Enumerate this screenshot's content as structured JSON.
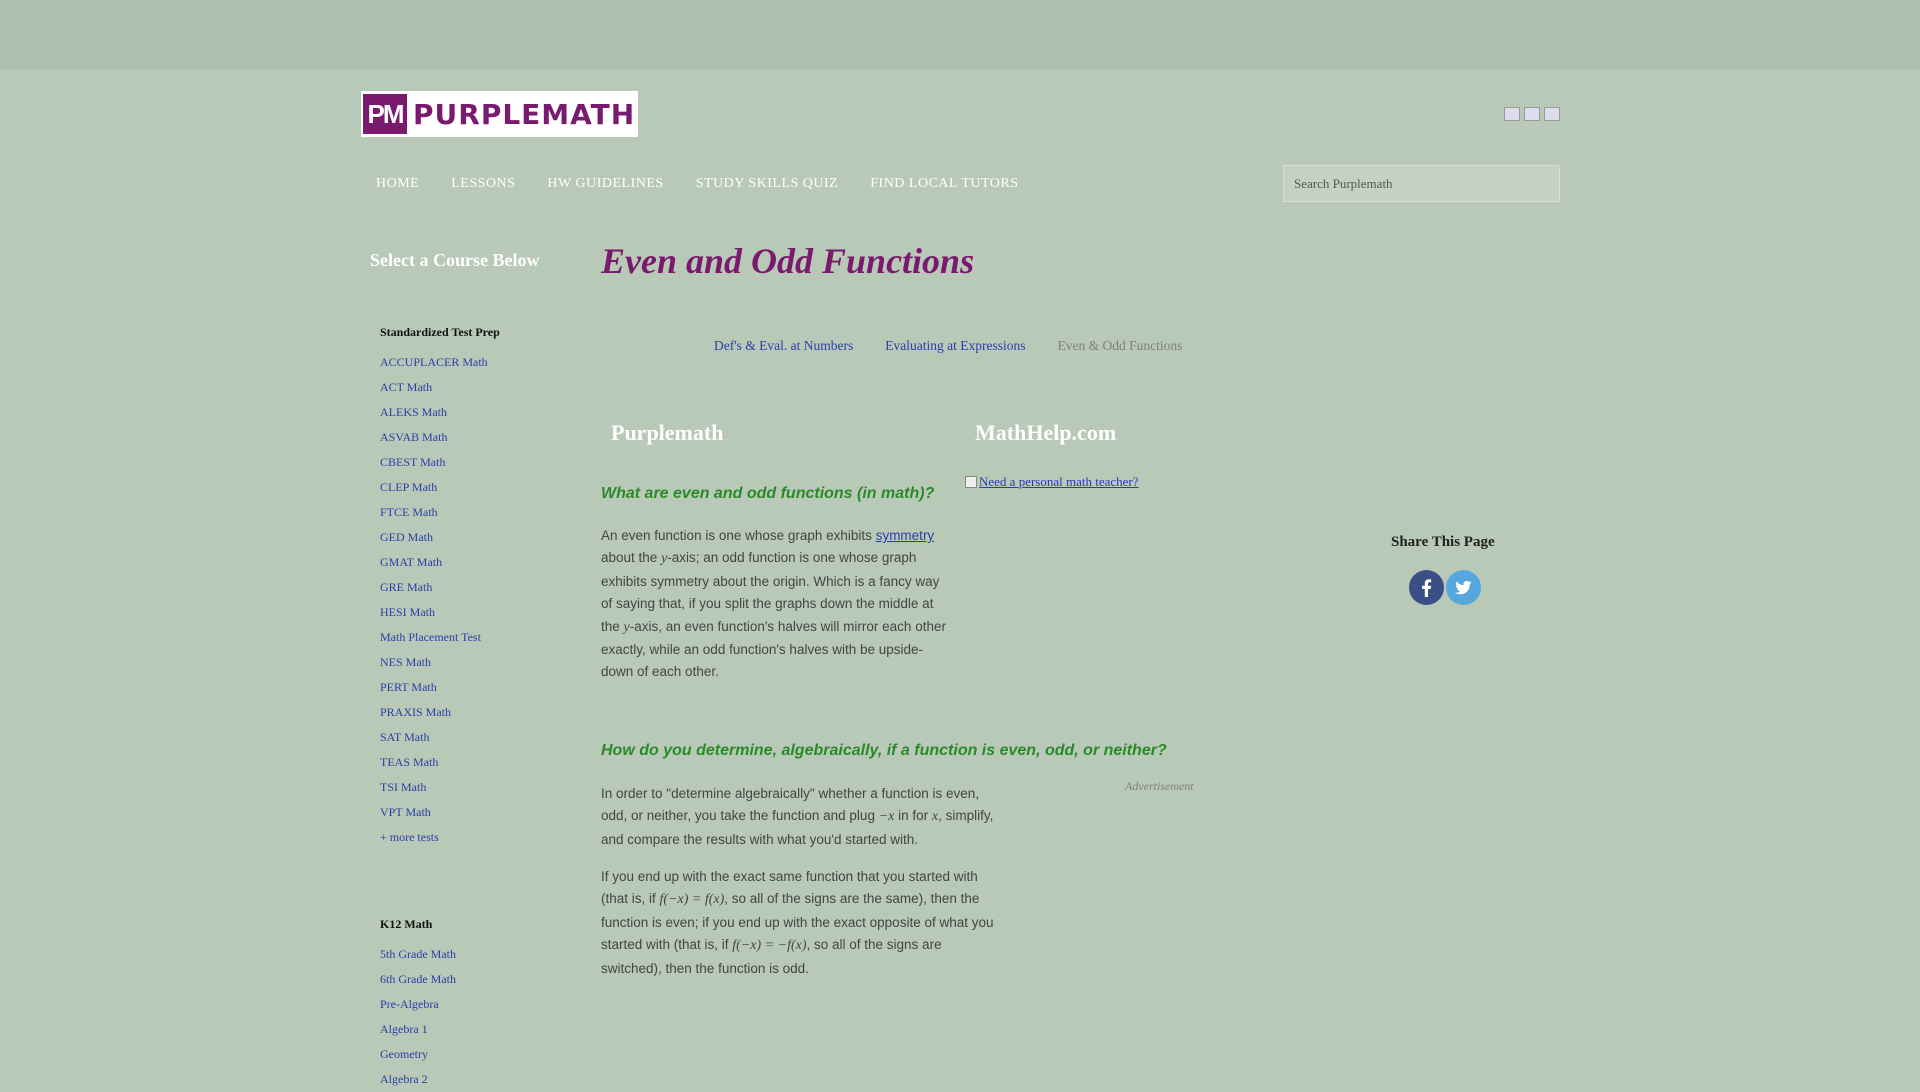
{
  "logo": {
    "mark": "PM",
    "text": "PURPLEMATH"
  },
  "nav": [
    "HOME",
    "LESSONS",
    "HW GUIDELINES",
    "STUDY SKILLS QUIZ",
    "FIND LOCAL TUTORS"
  ],
  "search": {
    "placeholder": "Search Purplemath"
  },
  "sidebar": {
    "title": "Select a Course Below",
    "test_prep": {
      "heading": "Standardized Test Prep",
      "items": [
        "ACCUPLACER Math",
        "ACT Math",
        "ALEKS Math",
        "ASVAB Math",
        "CBEST Math",
        "CLEP Math",
        "FTCE Math",
        "GED Math",
        "GMAT Math",
        "GRE Math",
        "HESI Math",
        "Math Placement Test",
        "NES Math",
        "PERT Math",
        "PRAXIS Math",
        "SAT Math",
        "TEAS Math",
        "TSI Math",
        "VPT Math",
        "+ more tests"
      ]
    },
    "k12": {
      "heading": "K12 Math",
      "items": [
        "5th Grade Math",
        "6th Grade Math",
        "Pre-Algebra",
        "Algebra 1",
        "Geometry",
        "Algebra 2"
      ]
    }
  },
  "main": {
    "title": "Even and Odd Functions",
    "breadcrumbs": [
      {
        "label": "Def's & Eval. at Numbers",
        "link": true
      },
      {
        "label": "Evaluating at Expressions",
        "link": true
      },
      {
        "label": "Even & Odd Functions",
        "link": false
      }
    ],
    "brand_left": "Purplemath",
    "brand_right": "MathHelp.com",
    "ad_link": "Need a personal math teacher?",
    "q1": "What are even and odd functions (in math)?",
    "p1": {
      "a": "An even function is one whose graph exhibits ",
      "link": "symmetry",
      "b": " about the ",
      "y1": "y",
      "c": "-axis; an odd function is one whose graph exhibits symmetry about the origin. Which is a fancy way of saying that, if you split the graphs down the middle at the ",
      "y2": "y",
      "d": "-axis, an even function's halves will mirror each other exactly, while an odd function's halves with be upside-down of each other."
    },
    "q2": "How do you determine, algebraically, if a function is even, odd, or neither?",
    "advertisement": "Advertisement",
    "p2": {
      "a": "In order to \"determine algebraically\" whether a function is even, odd, or neither, you take the function and plug ",
      "negx": "−x",
      "b": " in for ",
      "x": "x",
      "c": ", simplify, and compare the results with what you'd started with."
    },
    "p3": {
      "a": "If you end up with the exact same function that you started with (that is, if ",
      "m1": "f(−x) = f(x)",
      "b": ", so all of the signs are the same), then the function is even; if you end up with the exact opposite of what you started with (that is, if ",
      "m2": "f(−x) = −f(x)",
      "c": ", so all of the signs are switched), then the function is odd."
    }
  },
  "share": {
    "title": "Share This Page",
    "buttons": [
      "facebook-icon",
      "twitter-icon"
    ]
  },
  "colors": {
    "purple": "#7a1a6e",
    "green": "#2a8a2a",
    "link": "#2a3ea8",
    "background": "#b8c9b8"
  }
}
